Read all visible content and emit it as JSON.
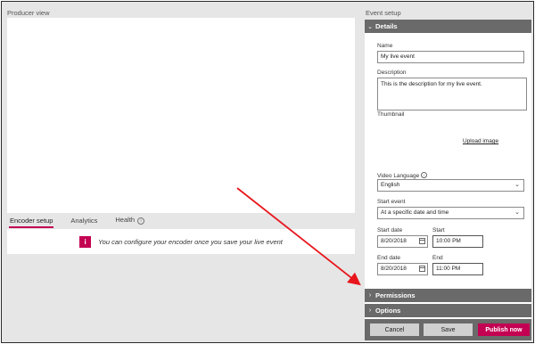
{
  "producer": {
    "title": "Producer view",
    "tabs": [
      {
        "label": "Encoder setup"
      },
      {
        "label": "Analytics"
      },
      {
        "label": "Health"
      }
    ],
    "encoder_message": "You can configure your encoder once you save your live event",
    "encoder_icon": "info-icon"
  },
  "setup": {
    "title": "Event setup",
    "details_header": "Details",
    "name_label": "Name",
    "name_value": "My live event",
    "description_label": "Description",
    "description_value": "This is the description for my live event.",
    "thumbnail_label": "Thumbnail",
    "upload_label": "Upload image",
    "language_label": "Video Language",
    "language_value": "English",
    "start_event_label": "Start event",
    "start_event_value": "At a specific date and time",
    "start_date_label": "Start date",
    "start_date_value": "8/20/2018",
    "start_time_label": "Start",
    "start_time_value": "10:00 PM",
    "end_date_label": "End date",
    "end_date_value": "8/20/2018",
    "end_time_label": "End",
    "end_time_value": "11:00 PM",
    "permissions_header": "Permissions",
    "options_header": "Options"
  },
  "footer": {
    "cancel_label": "Cancel",
    "save_label": "Save",
    "publish_label": "Publish now"
  },
  "colors": {
    "accent": "#c30052",
    "section_header": "#6a6a6a",
    "annotation_arrow": "#e8161c"
  }
}
